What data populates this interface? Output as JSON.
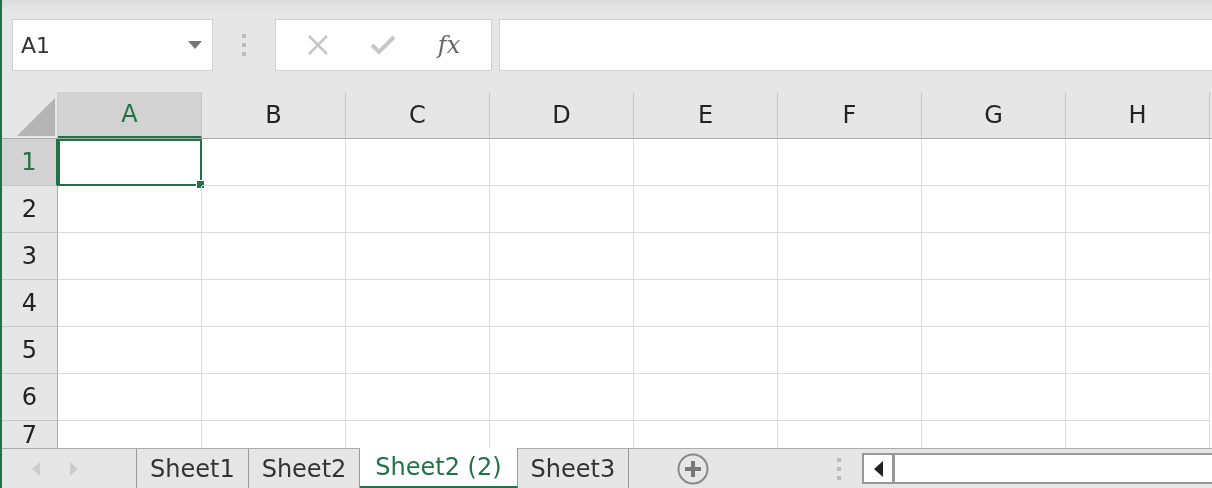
{
  "name_box": {
    "value": "A1"
  },
  "formula_bar": {
    "function_label": "fx"
  },
  "columns": [
    {
      "label": "A",
      "selected": true
    },
    {
      "label": "B",
      "selected": false
    },
    {
      "label": "C",
      "selected": false
    },
    {
      "label": "D",
      "selected": false
    },
    {
      "label": "E",
      "selected": false
    },
    {
      "label": "F",
      "selected": false
    },
    {
      "label": "G",
      "selected": false
    },
    {
      "label": "H",
      "selected": false
    }
  ],
  "rows": [
    {
      "label": "1",
      "selected": true,
      "cells": [
        {
          "selected": true
        },
        {
          "selected": false
        },
        {
          "selected": false
        },
        {
          "selected": false
        },
        {
          "selected": false
        },
        {
          "selected": false
        },
        {
          "selected": false
        },
        {
          "selected": false
        }
      ]
    },
    {
      "label": "2",
      "selected": false,
      "cells": [
        {
          "selected": false
        },
        {
          "selected": false
        },
        {
          "selected": false
        },
        {
          "selected": false
        },
        {
          "selected": false
        },
        {
          "selected": false
        },
        {
          "selected": false
        },
        {
          "selected": false
        }
      ]
    },
    {
      "label": "3",
      "selected": false,
      "cells": [
        {
          "selected": false
        },
        {
          "selected": false
        },
        {
          "selected": false
        },
        {
          "selected": false
        },
        {
          "selected": false
        },
        {
          "selected": false
        },
        {
          "selected": false
        },
        {
          "selected": false
        }
      ]
    },
    {
      "label": "4",
      "selected": false,
      "cells": [
        {
          "selected": false
        },
        {
          "selected": false
        },
        {
          "selected": false
        },
        {
          "selected": false
        },
        {
          "selected": false
        },
        {
          "selected": false
        },
        {
          "selected": false
        },
        {
          "selected": false
        }
      ]
    },
    {
      "label": "5",
      "selected": false,
      "cells": [
        {
          "selected": false
        },
        {
          "selected": false
        },
        {
          "selected": false
        },
        {
          "selected": false
        },
        {
          "selected": false
        },
        {
          "selected": false
        },
        {
          "selected": false
        },
        {
          "selected": false
        }
      ]
    },
    {
      "label": "6",
      "selected": false,
      "cells": [
        {
          "selected": false
        },
        {
          "selected": false
        },
        {
          "selected": false
        },
        {
          "selected": false
        },
        {
          "selected": false
        },
        {
          "selected": false
        },
        {
          "selected": false
        },
        {
          "selected": false
        }
      ]
    },
    {
      "label": "7",
      "selected": false,
      "cells": [
        {
          "selected": false
        },
        {
          "selected": false
        },
        {
          "selected": false
        },
        {
          "selected": false
        },
        {
          "selected": false
        },
        {
          "selected": false
        },
        {
          "selected": false
        },
        {
          "selected": false
        }
      ]
    }
  ],
  "sheet_tabs": [
    {
      "label": "Sheet1",
      "selected": false
    },
    {
      "label": "Sheet2",
      "selected": false
    },
    {
      "label": "Sheet2 (2)",
      "selected": true
    },
    {
      "label": "Sheet3",
      "selected": false
    }
  ]
}
